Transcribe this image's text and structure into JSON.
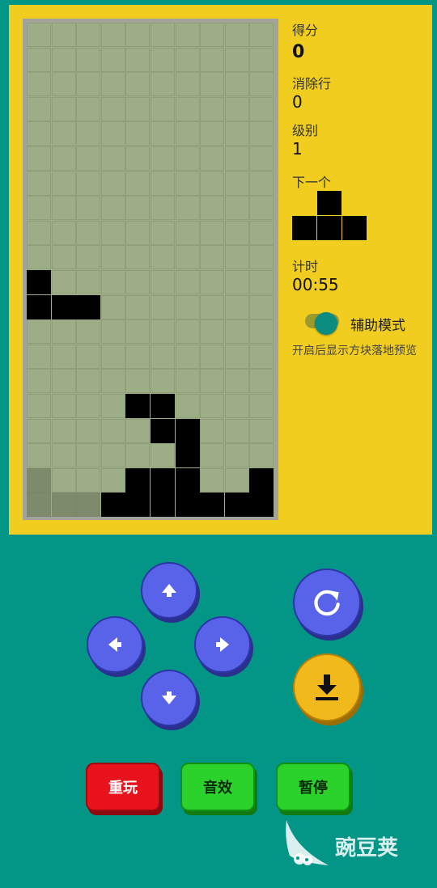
{
  "stats": {
    "score_label": "得分",
    "score_value": "0",
    "lines_label": "消除行",
    "lines_value": "0",
    "level_label": "级别",
    "level_value": "1",
    "next_label": "下一个",
    "timer_label": "计时",
    "timer_value": "00:55"
  },
  "assist": {
    "label": "辅助模式",
    "enabled": true,
    "hint": "开启后显示方块落地预览"
  },
  "board": {
    "cols": 10,
    "rows": 20,
    "filled": [
      [
        0,
        10
      ],
      [
        0,
        11
      ],
      [
        1,
        11
      ],
      [
        2,
        11
      ],
      [
        4,
        15
      ],
      [
        5,
        15
      ],
      [
        5,
        16
      ],
      [
        6,
        16
      ],
      [
        6,
        17
      ],
      [
        4,
        18
      ],
      [
        5,
        18
      ],
      [
        6,
        18
      ],
      [
        9,
        18
      ],
      [
        3,
        19
      ],
      [
        4,
        19
      ],
      [
        5,
        19
      ],
      [
        6,
        19
      ],
      [
        7,
        19
      ],
      [
        8,
        19
      ],
      [
        9,
        19
      ]
    ],
    "ghost": [
      [
        0,
        18
      ],
      [
        0,
        19
      ],
      [
        1,
        19
      ],
      [
        2,
        19
      ]
    ]
  },
  "next_piece": {
    "name": "T",
    "cells": [
      [
        1,
        0
      ],
      [
        0,
        1
      ],
      [
        1,
        1
      ],
      [
        2,
        1
      ]
    ]
  },
  "controls": {
    "up_icon": "arrow-up-icon",
    "left_icon": "arrow-left-icon",
    "right_icon": "arrow-right-icon",
    "down_icon": "arrow-down-icon",
    "rotate_icon": "rotate-icon",
    "drop_icon": "hard-drop-icon",
    "restart_label": "重玩",
    "sound_label": "音效",
    "pause_label": "暂停"
  },
  "watermark": {
    "text": "豌豆荚",
    "icon": "wandoujia-logo-icon"
  },
  "colors": {
    "background": "#039687",
    "panel": "#f0cd1e",
    "board": "#9dad86",
    "direction_button": "#5963ea",
    "drop_button": "#f2b91c",
    "restart_button": "#e8121c",
    "green_button": "#2bd22b"
  }
}
